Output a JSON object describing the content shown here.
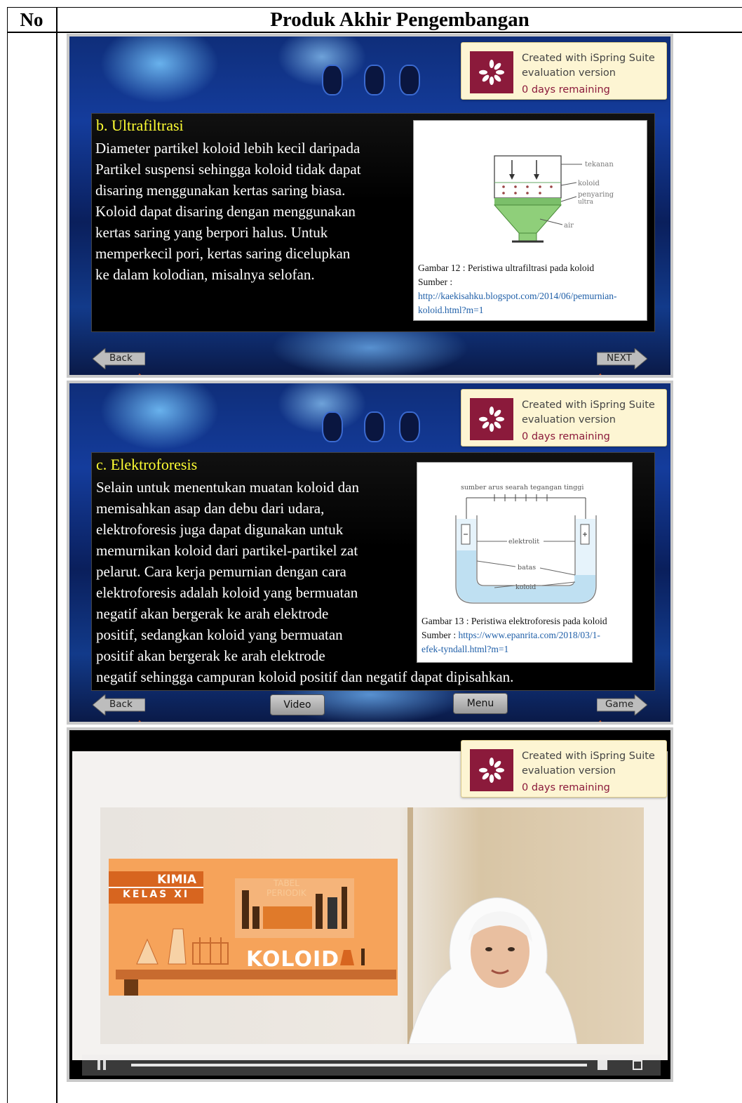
{
  "table": {
    "col1_header": "No",
    "col2_header": "Produk Akhir Pengembangan"
  },
  "watermark": {
    "line1": "Created with iSpring Suite",
    "line2": "evaluation version",
    "line3": "0 days remaining",
    "logo_icon": "ispring-flower-icon"
  },
  "slide1": {
    "heading": "b. Ultrafiltrasi",
    "body_lines": [
      "Diameter partikel koloid lebih kecil daripada",
      "Partikel suspensi sehingga koloid tidak dapat",
      "disaring menggunakan kertas saring biasa.",
      "Koloid dapat disaring dengan menggunakan",
      "kertas saring yang berpori halus. Untuk",
      "memperkecil pori, kertas saring dicelupkan",
      "ke dalam kolodian, misalnya selofan."
    ],
    "figure_labels": {
      "tekanan": "tekanan",
      "koloid": "koloid",
      "penyaring": "penyaring",
      "ultra": "ultra",
      "air": "air"
    },
    "caption": "Gambar  12 : Peristiwa ultrafiltrasi pada koloid",
    "source_label": "Sumber  :",
    "source_link_1": "http://kaekisahku.blogspot.com/2014/06/pemurnian-",
    "source_link_2": "koloid.html?m=1",
    "back_label": "Back",
    "next_label": "NEXT"
  },
  "slide2": {
    "heading": "c. Elektroforesis",
    "body_lines": [
      "Selain untuk menentukan muatan koloid dan",
      "memisahkan asap dan debu dari udara,",
      "elektroforesis juga dapat digunakan untuk",
      "memurnikan koloid dari partikel-partikel zat",
      "pelarut. Cara kerja pemurnian dengan cara",
      "elektroforesis adalah koloid yang bermuatan",
      "negatif akan bergerak ke arah elektrode",
      "positif, sedangkan koloid yang bermuatan",
      "positif akan bergerak ke arah elektrode",
      "negatif sehingga campuran koloid positif dan negatif dapat dipisahkan."
    ],
    "figure_labels": {
      "top": "sumber arus searah tegangan tinggi",
      "elektrolit": "elektrolit",
      "batas": "batas",
      "koloid": "koloid"
    },
    "caption": "Gambar  13 : Peristiwa elektroforesis pada koloid",
    "source_label": "Sumber  :",
    "source_link_1": "https://www.epanrita.com/2018/03/1-",
    "source_link_2": "efek-tyndall.html?m=1",
    "back_label": "Back",
    "video_label": "Video",
    "menu_label": "Menu",
    "game_label": "Game"
  },
  "video": {
    "kimia": "KIMIA",
    "kelas": "KELAS XI",
    "tabel_1": "TABEL",
    "tabel_2": "PERIODIK",
    "koloid": "KOLOID"
  }
}
